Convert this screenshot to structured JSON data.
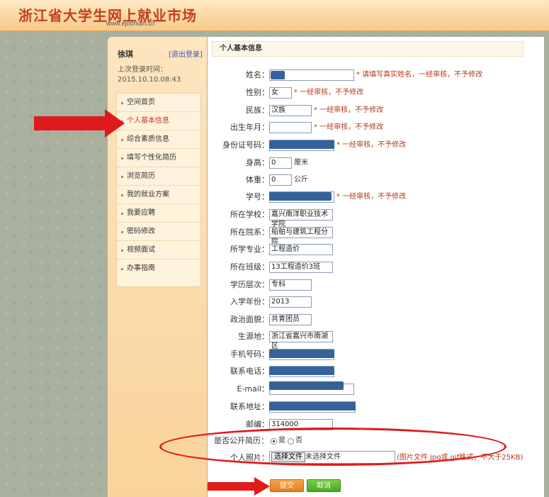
{
  "header": {
    "logo_text": "浙江省大学生网上就业市场",
    "logo_url": "www.ejobmart.cn"
  },
  "sidebar": {
    "username": "徐琪",
    "logout_label": "[退出登录]",
    "last_login_label": "上次登录时间：",
    "last_login_time": "2015.10.10.08:43",
    "items": [
      {
        "label": "空间首页"
      },
      {
        "label": "个人基本信息"
      },
      {
        "label": "综合素质信息"
      },
      {
        "label": "填写个性化简历"
      },
      {
        "label": "浏览简历"
      },
      {
        "label": "我的就业方案"
      },
      {
        "label": "我要应聘"
      },
      {
        "label": "密码修改"
      },
      {
        "label": "视频面试"
      },
      {
        "label": "办事指南"
      }
    ]
  },
  "main": {
    "title": "个人基本信息"
  },
  "form": {
    "name": {
      "label": "姓名：",
      "value": "",
      "note": "* 请填写真实姓名，一经审核，不予修改"
    },
    "gender": {
      "label": "性别：",
      "value": "女",
      "note": "* 一经审核，不予修改"
    },
    "ethnicity": {
      "label": "民族：",
      "value": "汉族",
      "note": "* 一经审核，不予修改"
    },
    "birth": {
      "label": "出生年月：",
      "value": "",
      "note": "* 一经审核，不予修改"
    },
    "id_number": {
      "label": "身份证号码：",
      "value": "",
      "note": "* 一经审核，不予修改"
    },
    "height": {
      "label": "身高：",
      "value": "0",
      "unit": "厘米"
    },
    "weight": {
      "label": "体重：",
      "value": "0",
      "unit": "公斤"
    },
    "student_id": {
      "label": "学号：",
      "value": "",
      "note": "* 一经审核，不予修改"
    },
    "school": {
      "label": "所在学校：",
      "value": "嘉兴南洋职业技术学院"
    },
    "department": {
      "label": "所在院系：",
      "value": "船舶与建筑工程分院"
    },
    "major": {
      "label": "所学专业：",
      "value": "工程造价"
    },
    "class": {
      "label": "所在班级：",
      "value": "13工程造价3班"
    },
    "education": {
      "label": "学历层次：",
      "value": "专科"
    },
    "enroll_year": {
      "label": "入学年份：",
      "value": "2013"
    },
    "political": {
      "label": "政治面貌：",
      "value": "共青团员"
    },
    "origin": {
      "label": "生源地：",
      "value": "浙江省嘉兴市南湖区"
    },
    "mobile": {
      "label": "手机号码：",
      "value": ""
    },
    "phone": {
      "label": "联系电话：",
      "value": ""
    },
    "email": {
      "label": "E-mail：",
      "value": ""
    },
    "address": {
      "label": "联系地址：",
      "value": ""
    },
    "postcode": {
      "label": "邮编：",
      "value": "314000"
    },
    "public_resume": {
      "label": "是否公开简历：",
      "yes": "是",
      "no": "否"
    },
    "photo": {
      "label": "个人照片：",
      "button": "选择文件",
      "status": "未选择文件",
      "hint": "(图片文件.jpg或.gif格式，不大于25KB)"
    }
  },
  "actions": {
    "submit": "提交",
    "cancel": "取消"
  },
  "colors": {
    "annotation_red": "#e01a1a",
    "redaction_blue": "#35629b",
    "submit_orange": "#e67d1f",
    "cancel_green": "#4aa823"
  }
}
